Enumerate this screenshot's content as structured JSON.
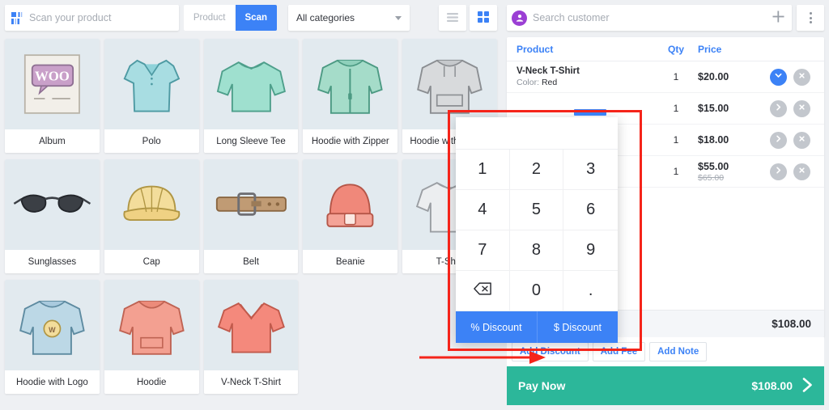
{
  "toolbar": {
    "scan_placeholder": "Scan your product",
    "scan_icon": "barcode-scanner-icon",
    "product_label": "Product",
    "scan_label": "Scan",
    "category_label": "All categories",
    "list_view_icon": "list-view-icon",
    "grid_view_icon": "grid-view-icon"
  },
  "products": [
    {
      "name": "Album",
      "image": "woo-album-cover"
    },
    {
      "name": "Polo",
      "image": "polo-shirt"
    },
    {
      "name": "Long Sleeve Tee",
      "image": "long-sleeve-tee"
    },
    {
      "name": "Hoodie with Zipper",
      "image": "hoodie-with-zipper"
    },
    {
      "name": "Hoodie with Pocket",
      "image": "hoodie-with-pocket"
    },
    {
      "name": "Sunglasses",
      "image": "sunglasses"
    },
    {
      "name": "Cap",
      "image": "cap"
    },
    {
      "name": "Belt",
      "image": "belt"
    },
    {
      "name": "Beanie",
      "image": "beanie"
    },
    {
      "name": "T-Shirt",
      "image": "t-shirt"
    },
    {
      "name": "Hoodie with Logo",
      "image": "hoodie-with-logo"
    },
    {
      "name": "Hoodie",
      "image": "hoodie"
    },
    {
      "name": "V-Neck T-Shirt",
      "image": "v-neck-t-shirt"
    }
  ],
  "customer": {
    "placeholder": "Search customer",
    "avatar_icon": "user-avatar-icon",
    "add_icon": "plus-icon",
    "menu_icon": "kebab-menu-icon"
  },
  "cart": {
    "headers": {
      "product": "Product",
      "qty": "Qty",
      "price": "Price"
    },
    "rows": [
      {
        "name": "V-Neck T-Shirt",
        "meta_label": "Color",
        "meta_value": "Red",
        "qty": "1",
        "price": "$20.00",
        "price_old": "",
        "expand_icon": "chevron-down-icon",
        "expanded": true
      },
      {
        "name": "",
        "meta_label": "",
        "meta_value": "",
        "qty": "1",
        "price": "$15.00",
        "price_old": "",
        "expand_icon": "chevron-right-icon",
        "expanded": false
      },
      {
        "name": "",
        "meta_label": "",
        "meta_value": "",
        "qty": "1",
        "price": "$18.00",
        "price_old": "",
        "expand_icon": "chevron-right-icon",
        "expanded": false
      },
      {
        "name": "",
        "meta_label": "",
        "meta_value": "",
        "qty": "1",
        "price": "$55.00",
        "price_old": "$65.00",
        "expand_icon": "chevron-right-icon",
        "expanded": false
      }
    ],
    "remove_icon": "remove-circle-icon",
    "total": "$108.00"
  },
  "mini_actions": {
    "add_discount": "Add Discount",
    "add_fee": "Add Fee",
    "add_note": "Add Note"
  },
  "pay": {
    "label": "Pay Now",
    "amount": "$108.00",
    "arrow_icon": "chevron-right-icon"
  },
  "numpad": {
    "display": "",
    "keys": [
      "1",
      "2",
      "3",
      "4",
      "5",
      "6",
      "7",
      "8",
      "9",
      "⌫",
      "0",
      "."
    ],
    "backspace_icon": "backspace-icon",
    "percent_discount": "% Discount",
    "dollar_discount": "$ Discount"
  },
  "colors": {
    "accent_blue": "#3c82f6",
    "pay_green": "#2cb79a",
    "annotation_red": "#f5241a",
    "avatar_purple": "#9b3fd4",
    "tile_bg": "#e2eaef"
  }
}
